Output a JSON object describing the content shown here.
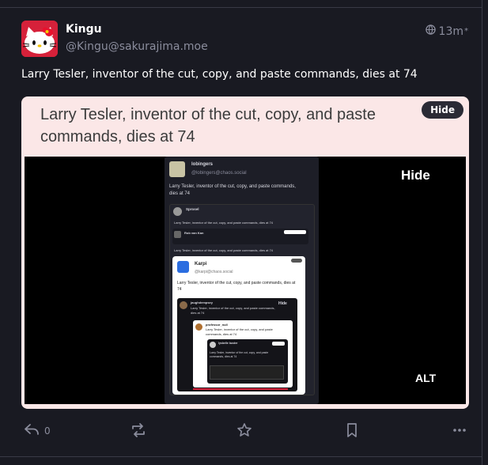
{
  "post": {
    "author_name": "Kingu",
    "author_handle": "@Kingu@sakurajima.moe",
    "timestamp": "13m",
    "visibility_icon": "globe-icon",
    "text": "Larry Tesler, inventor of the cut, copy, and paste commands, dies at 74"
  },
  "media": {
    "title": "Larry Tesler, inventor of the cut, copy, and paste commands, dies at 74",
    "hide_label": "Hide",
    "inner_hide_label": "Hide",
    "alt_label": "ALT",
    "screenshot": {
      "author_name": "lobingers",
      "author_handle": "@lobingers@chaos.social",
      "text": "Larry Tesler, inventor of the cut, copy, and paste commands, dies at 74",
      "level2_name": "Sprosel",
      "level2_text": "Larry Tesler, inventor of the cut, copy, and paste commands, dies at 74",
      "level3_name": "Rob van Kan",
      "level3_text": "Larry Tesler, inventor of the cut, copy, and paste commands, dies at 74",
      "level4_name": "Karpi",
      "level4_handle": "@karpi@chaos.social",
      "level4_text": "Larry Tesler, inventor of the cut, copy, and paste commands, dies at 74",
      "level5_name": "jaughdempsey",
      "level5_text": "Larry Tesler, inventor of the cut, copy, and paste commands, dies at 74",
      "level6_name": "professor_null",
      "level6_text": "Larry Tesler, inventor of the cut, copy, and paste commands, dies at 74",
      "level7_name": "lysbelle buster",
      "level7_text": "Larry Tesler, inventor of the cut, copy, and paste commands, dies at 74"
    }
  },
  "actions": {
    "reply_count": "0",
    "reply_icon": "reply-icon",
    "boost_icon": "boost-icon",
    "favourite_icon": "star-icon",
    "bookmark_icon": "bookmark-icon",
    "more_icon": "more-icon"
  },
  "colors": {
    "background": "#191a22",
    "media_header": "#fbe7e7",
    "muted": "#8b8d9d"
  }
}
